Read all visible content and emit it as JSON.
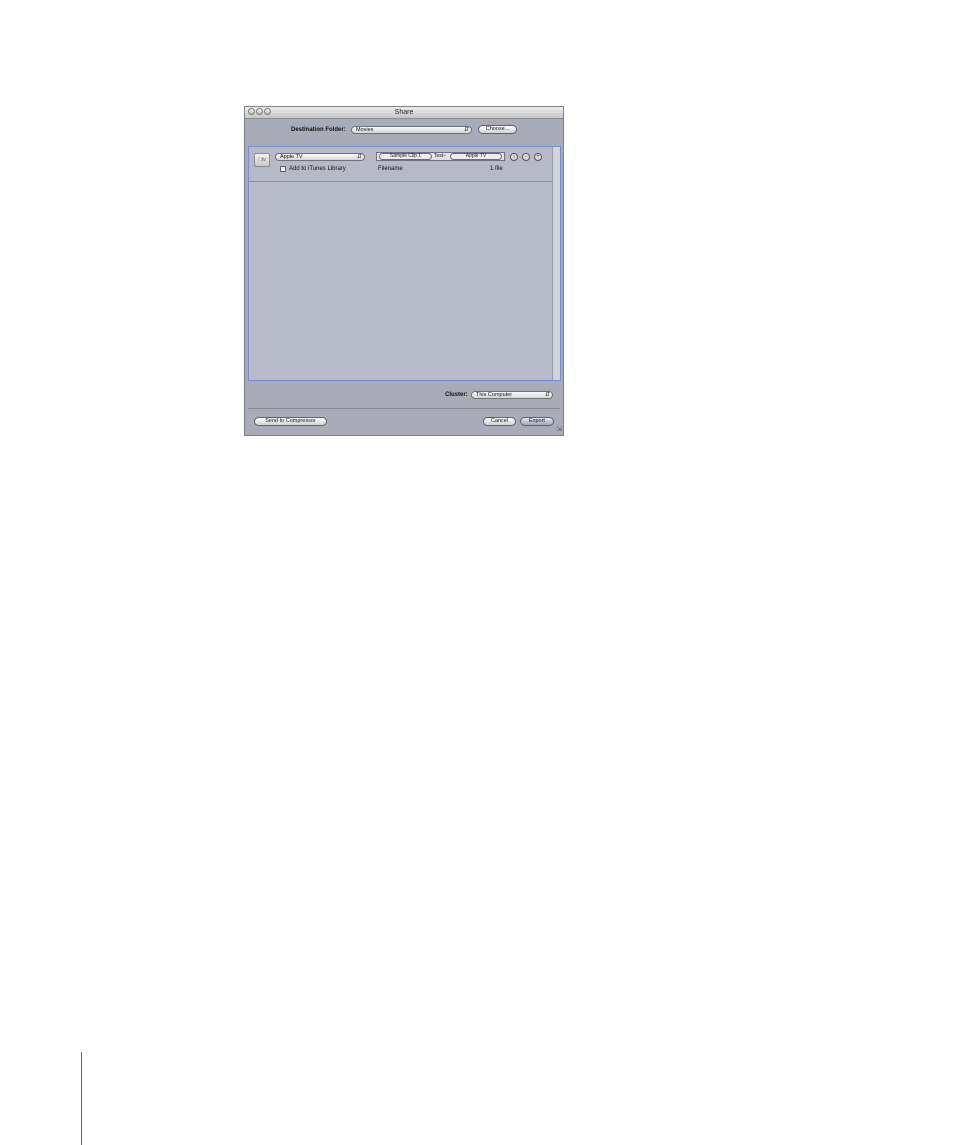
{
  "window": {
    "title": "Share"
  },
  "destination": {
    "label": "Destination Folder:",
    "value": "Movies",
    "choose_label": "Choose..."
  },
  "output_row": {
    "icon": "apple-tv-device-icon",
    "preset": "Apple TV",
    "add_to_itunes_label": "Add to iTunes Library",
    "add_to_itunes_checked": false,
    "filename_tokens": [
      "Sample Clip 1",
      "Test–",
      "Apple TV"
    ],
    "filename_label": "Filename",
    "file_count": "1 file",
    "info_icon": "info-icon",
    "remove_icon": "minus-icon",
    "add_icon": "plus-icon"
  },
  "cluster": {
    "label": "Cluster:",
    "value": "This Computer"
  },
  "footer": {
    "send_label": "Send to Compressor",
    "cancel_label": "Cancel",
    "export_label": "Export"
  }
}
